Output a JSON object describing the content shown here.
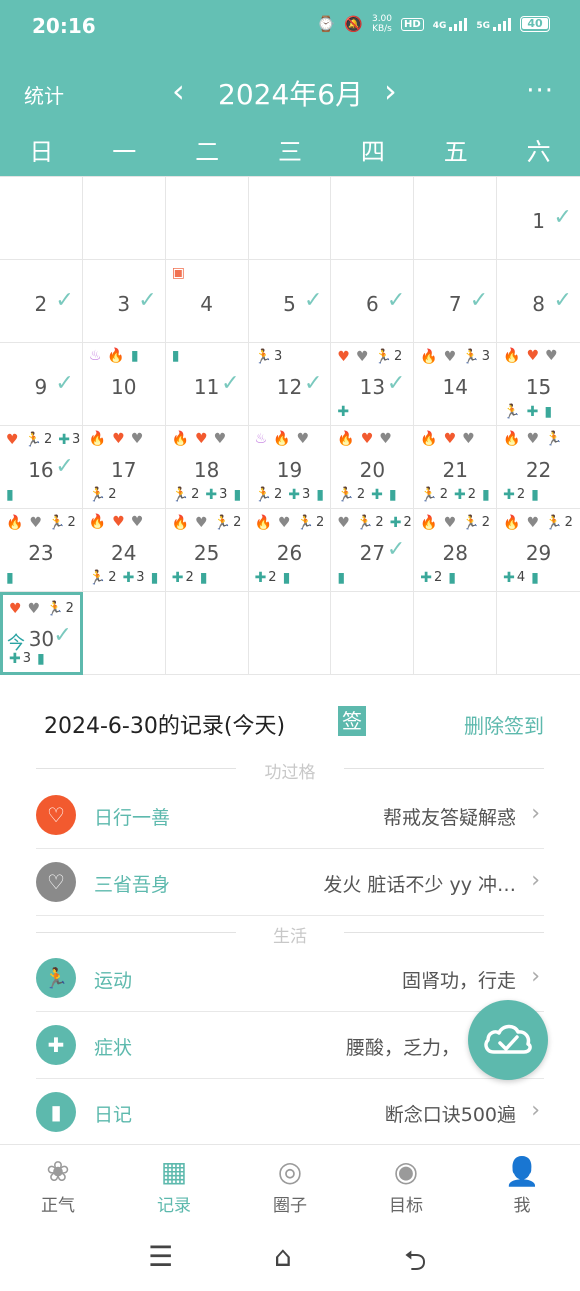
{
  "status_bar": {
    "time": "20:16",
    "speed": "3.00",
    "speed_unit": "KB/s",
    "hd": "HD",
    "net1": "4G",
    "net2": "5G",
    "battery": "40"
  },
  "header": {
    "stats_label": "统计",
    "title": "2024年6月",
    "prev": "‹",
    "next": "›",
    "more": "···"
  },
  "weekdays": [
    "日",
    "一",
    "二",
    "三",
    "四",
    "五",
    "六"
  ],
  "calendar": {
    "today_label": "今",
    "days": [
      {
        "day": ""
      },
      {
        "day": ""
      },
      {
        "day": ""
      },
      {
        "day": ""
      },
      {
        "day": ""
      },
      {
        "day": ""
      },
      {
        "day": "1",
        "checked": true
      },
      {
        "day": "2",
        "checked": true
      },
      {
        "day": "3",
        "checked": true
      },
      {
        "day": "4",
        "top": [
          {
            "icon": "gift-icon"
          }
        ]
      },
      {
        "day": "5",
        "checked": true
      },
      {
        "day": "6",
        "checked": true
      },
      {
        "day": "7",
        "checked": true
      },
      {
        "day": "8",
        "checked": true
      },
      {
        "day": "9",
        "checked": true
      },
      {
        "day": "10",
        "top": [
          {
            "icon": "yoga-icon"
          },
          {
            "icon": "fire-icon"
          },
          {
            "icon": "diary-icon"
          }
        ]
      },
      {
        "day": "11",
        "checked": true,
        "top": [
          {
            "icon": "diary-icon"
          }
        ]
      },
      {
        "day": "12",
        "checked": true,
        "top": [
          {
            "icon": "run-icon",
            "count": "3"
          }
        ]
      },
      {
        "day": "13",
        "checked": true,
        "top": [
          {
            "icon": "heart-icon"
          },
          {
            "icon": "broken-heart-icon"
          },
          {
            "icon": "run-icon",
            "count": "2"
          }
        ],
        "bottom": [
          {
            "icon": "medical-icon"
          }
        ]
      },
      {
        "day": "14",
        "top": [
          {
            "icon": "fire-icon"
          },
          {
            "icon": "broken-heart-icon"
          },
          {
            "icon": "run-icon",
            "count": "3"
          }
        ]
      },
      {
        "day": "15",
        "top": [
          {
            "icon": "fire-icon"
          },
          {
            "icon": "heart-icon"
          },
          {
            "icon": "broken-heart-icon"
          }
        ],
        "bottom": [
          {
            "icon": "run-icon"
          },
          {
            "icon": "medical-icon"
          },
          {
            "icon": "diary-icon"
          }
        ]
      },
      {
        "day": "16",
        "checked": true,
        "top": [
          {
            "icon": "heart-icon"
          },
          {
            "icon": "run-icon",
            "count": "2"
          },
          {
            "icon": "medical-icon",
            "count": "3"
          }
        ],
        "bottom": [
          {
            "icon": "diary-icon"
          }
        ]
      },
      {
        "day": "17",
        "top": [
          {
            "icon": "fire-icon"
          },
          {
            "icon": "heart-icon"
          },
          {
            "icon": "broken-heart-icon"
          }
        ],
        "bottom": [
          {
            "icon": "run-icon",
            "count": "2"
          }
        ]
      },
      {
        "day": "18",
        "top": [
          {
            "icon": "fire-icon"
          },
          {
            "icon": "heart-icon"
          },
          {
            "icon": "broken-heart-icon"
          }
        ],
        "bottom": [
          {
            "icon": "run-icon",
            "count": "2"
          },
          {
            "icon": "medical-icon",
            "count": "3"
          },
          {
            "icon": "diary-icon"
          }
        ]
      },
      {
        "day": "19",
        "top": [
          {
            "icon": "yoga-icon"
          },
          {
            "icon": "fire-icon"
          },
          {
            "icon": "broken-heart-icon"
          }
        ],
        "bottom": [
          {
            "icon": "run-icon",
            "count": "2"
          },
          {
            "icon": "medical-icon",
            "count": "3"
          },
          {
            "icon": "diary-icon"
          }
        ]
      },
      {
        "day": "20",
        "top": [
          {
            "icon": "fire-icon"
          },
          {
            "icon": "heart-icon"
          },
          {
            "icon": "broken-heart-icon"
          }
        ],
        "bottom": [
          {
            "icon": "run-icon",
            "count": "2"
          },
          {
            "icon": "medical-icon"
          },
          {
            "icon": "diary-icon"
          }
        ]
      },
      {
        "day": "21",
        "top": [
          {
            "icon": "fire-icon"
          },
          {
            "icon": "heart-icon"
          },
          {
            "icon": "broken-heart-icon"
          }
        ],
        "bottom": [
          {
            "icon": "run-icon",
            "count": "2"
          },
          {
            "icon": "medical-icon",
            "count": "2"
          },
          {
            "icon": "diary-icon"
          }
        ]
      },
      {
        "day": "22",
        "top": [
          {
            "icon": "fire-icon"
          },
          {
            "icon": "broken-heart-icon"
          },
          {
            "icon": "run-icon"
          }
        ],
        "bottom": [
          {
            "icon": "medical-icon",
            "count": "2"
          },
          {
            "icon": "diary-icon"
          }
        ]
      },
      {
        "day": "23",
        "top": [
          {
            "icon": "fire-icon"
          },
          {
            "icon": "broken-heart-icon"
          },
          {
            "icon": "run-icon",
            "count": "2"
          }
        ],
        "bottom": [
          {
            "icon": "diary-icon"
          }
        ]
      },
      {
        "day": "24",
        "top": [
          {
            "icon": "fire-icon"
          },
          {
            "icon": "heart-icon"
          },
          {
            "icon": "broken-heart-icon"
          }
        ],
        "bottom": [
          {
            "icon": "run-icon",
            "count": "2"
          },
          {
            "icon": "medical-icon",
            "count": "3"
          },
          {
            "icon": "diary-icon"
          }
        ]
      },
      {
        "day": "25",
        "top": [
          {
            "icon": "fire-icon"
          },
          {
            "icon": "broken-heart-icon"
          },
          {
            "icon": "run-icon",
            "count": "2"
          }
        ],
        "bottom": [
          {
            "icon": "medical-icon",
            "count": "2"
          },
          {
            "icon": "diary-icon"
          }
        ]
      },
      {
        "day": "26",
        "top": [
          {
            "icon": "fire-icon"
          },
          {
            "icon": "broken-heart-icon"
          },
          {
            "icon": "run-icon",
            "count": "2"
          }
        ],
        "bottom": [
          {
            "icon": "medical-icon",
            "count": "2"
          },
          {
            "icon": "diary-icon"
          }
        ]
      },
      {
        "day": "27",
        "checked": true,
        "top": [
          {
            "icon": "broken-heart-icon"
          },
          {
            "icon": "run-icon",
            "count": "2"
          },
          {
            "icon": "medical-icon",
            "count": "2"
          }
        ],
        "bottom": [
          {
            "icon": "diary-icon"
          }
        ]
      },
      {
        "day": "28",
        "top": [
          {
            "icon": "fire-icon"
          },
          {
            "icon": "broken-heart-icon"
          },
          {
            "icon": "run-icon",
            "count": "2"
          }
        ],
        "bottom": [
          {
            "icon": "medical-icon",
            "count": "2"
          },
          {
            "icon": "diary-icon"
          }
        ]
      },
      {
        "day": "29",
        "top": [
          {
            "icon": "fire-icon"
          },
          {
            "icon": "broken-heart-icon"
          },
          {
            "icon": "run-icon",
            "count": "2"
          }
        ],
        "bottom": [
          {
            "icon": "medical-icon",
            "count": "4"
          },
          {
            "icon": "diary-icon"
          }
        ]
      },
      {
        "day": "30",
        "checked": true,
        "today": true,
        "top": [
          {
            "icon": "heart-icon"
          },
          {
            "icon": "broken-heart-icon"
          },
          {
            "icon": "run-icon",
            "count": "2"
          }
        ],
        "bottom": [
          {
            "icon": "medical-icon",
            "count": "3"
          },
          {
            "icon": "diary-icon"
          }
        ]
      },
      {
        "day": ""
      },
      {
        "day": ""
      },
      {
        "day": ""
      },
      {
        "day": ""
      },
      {
        "day": ""
      },
      {
        "day": ""
      }
    ]
  },
  "records": {
    "title": "2024-6-30的记录(今天)",
    "sign_badge": "签",
    "delete_sign": "删除签到",
    "section_merit": "功过格",
    "section_life": "生活",
    "items": [
      {
        "name": "日行一善",
        "value": "帮戒友答疑解惑",
        "icon": "heart-icon",
        "color": "#f25a2f"
      },
      {
        "name": "三省吾身",
        "value": "发火  脏话不少  yy  冲…",
        "icon": "broken-heart-icon",
        "color": "#8a8a8a"
      },
      {
        "name": "运动",
        "value": "固肾功，行走",
        "icon": "run-icon",
        "color": "#5db9ad"
      },
      {
        "name": "症状",
        "value": "腰酸，乏力，",
        "icon": "medical-icon",
        "color": "#5db9ad"
      },
      {
        "name": "日记",
        "value": "断念口诀500遍",
        "icon": "diary-icon",
        "color": "#5db9ad"
      }
    ]
  },
  "tabs": [
    {
      "label": "正气",
      "icon": "lotus-icon"
    },
    {
      "label": "记录",
      "icon": "calendar-icon",
      "active": true
    },
    {
      "label": "圈子",
      "icon": "circle-icon"
    },
    {
      "label": "目标",
      "icon": "target-icon"
    },
    {
      "label": "我",
      "icon": "user-icon"
    }
  ],
  "colors": {
    "accent": "#5db9ad",
    "header": "#64c0b4",
    "merit": "#f25a2f"
  }
}
